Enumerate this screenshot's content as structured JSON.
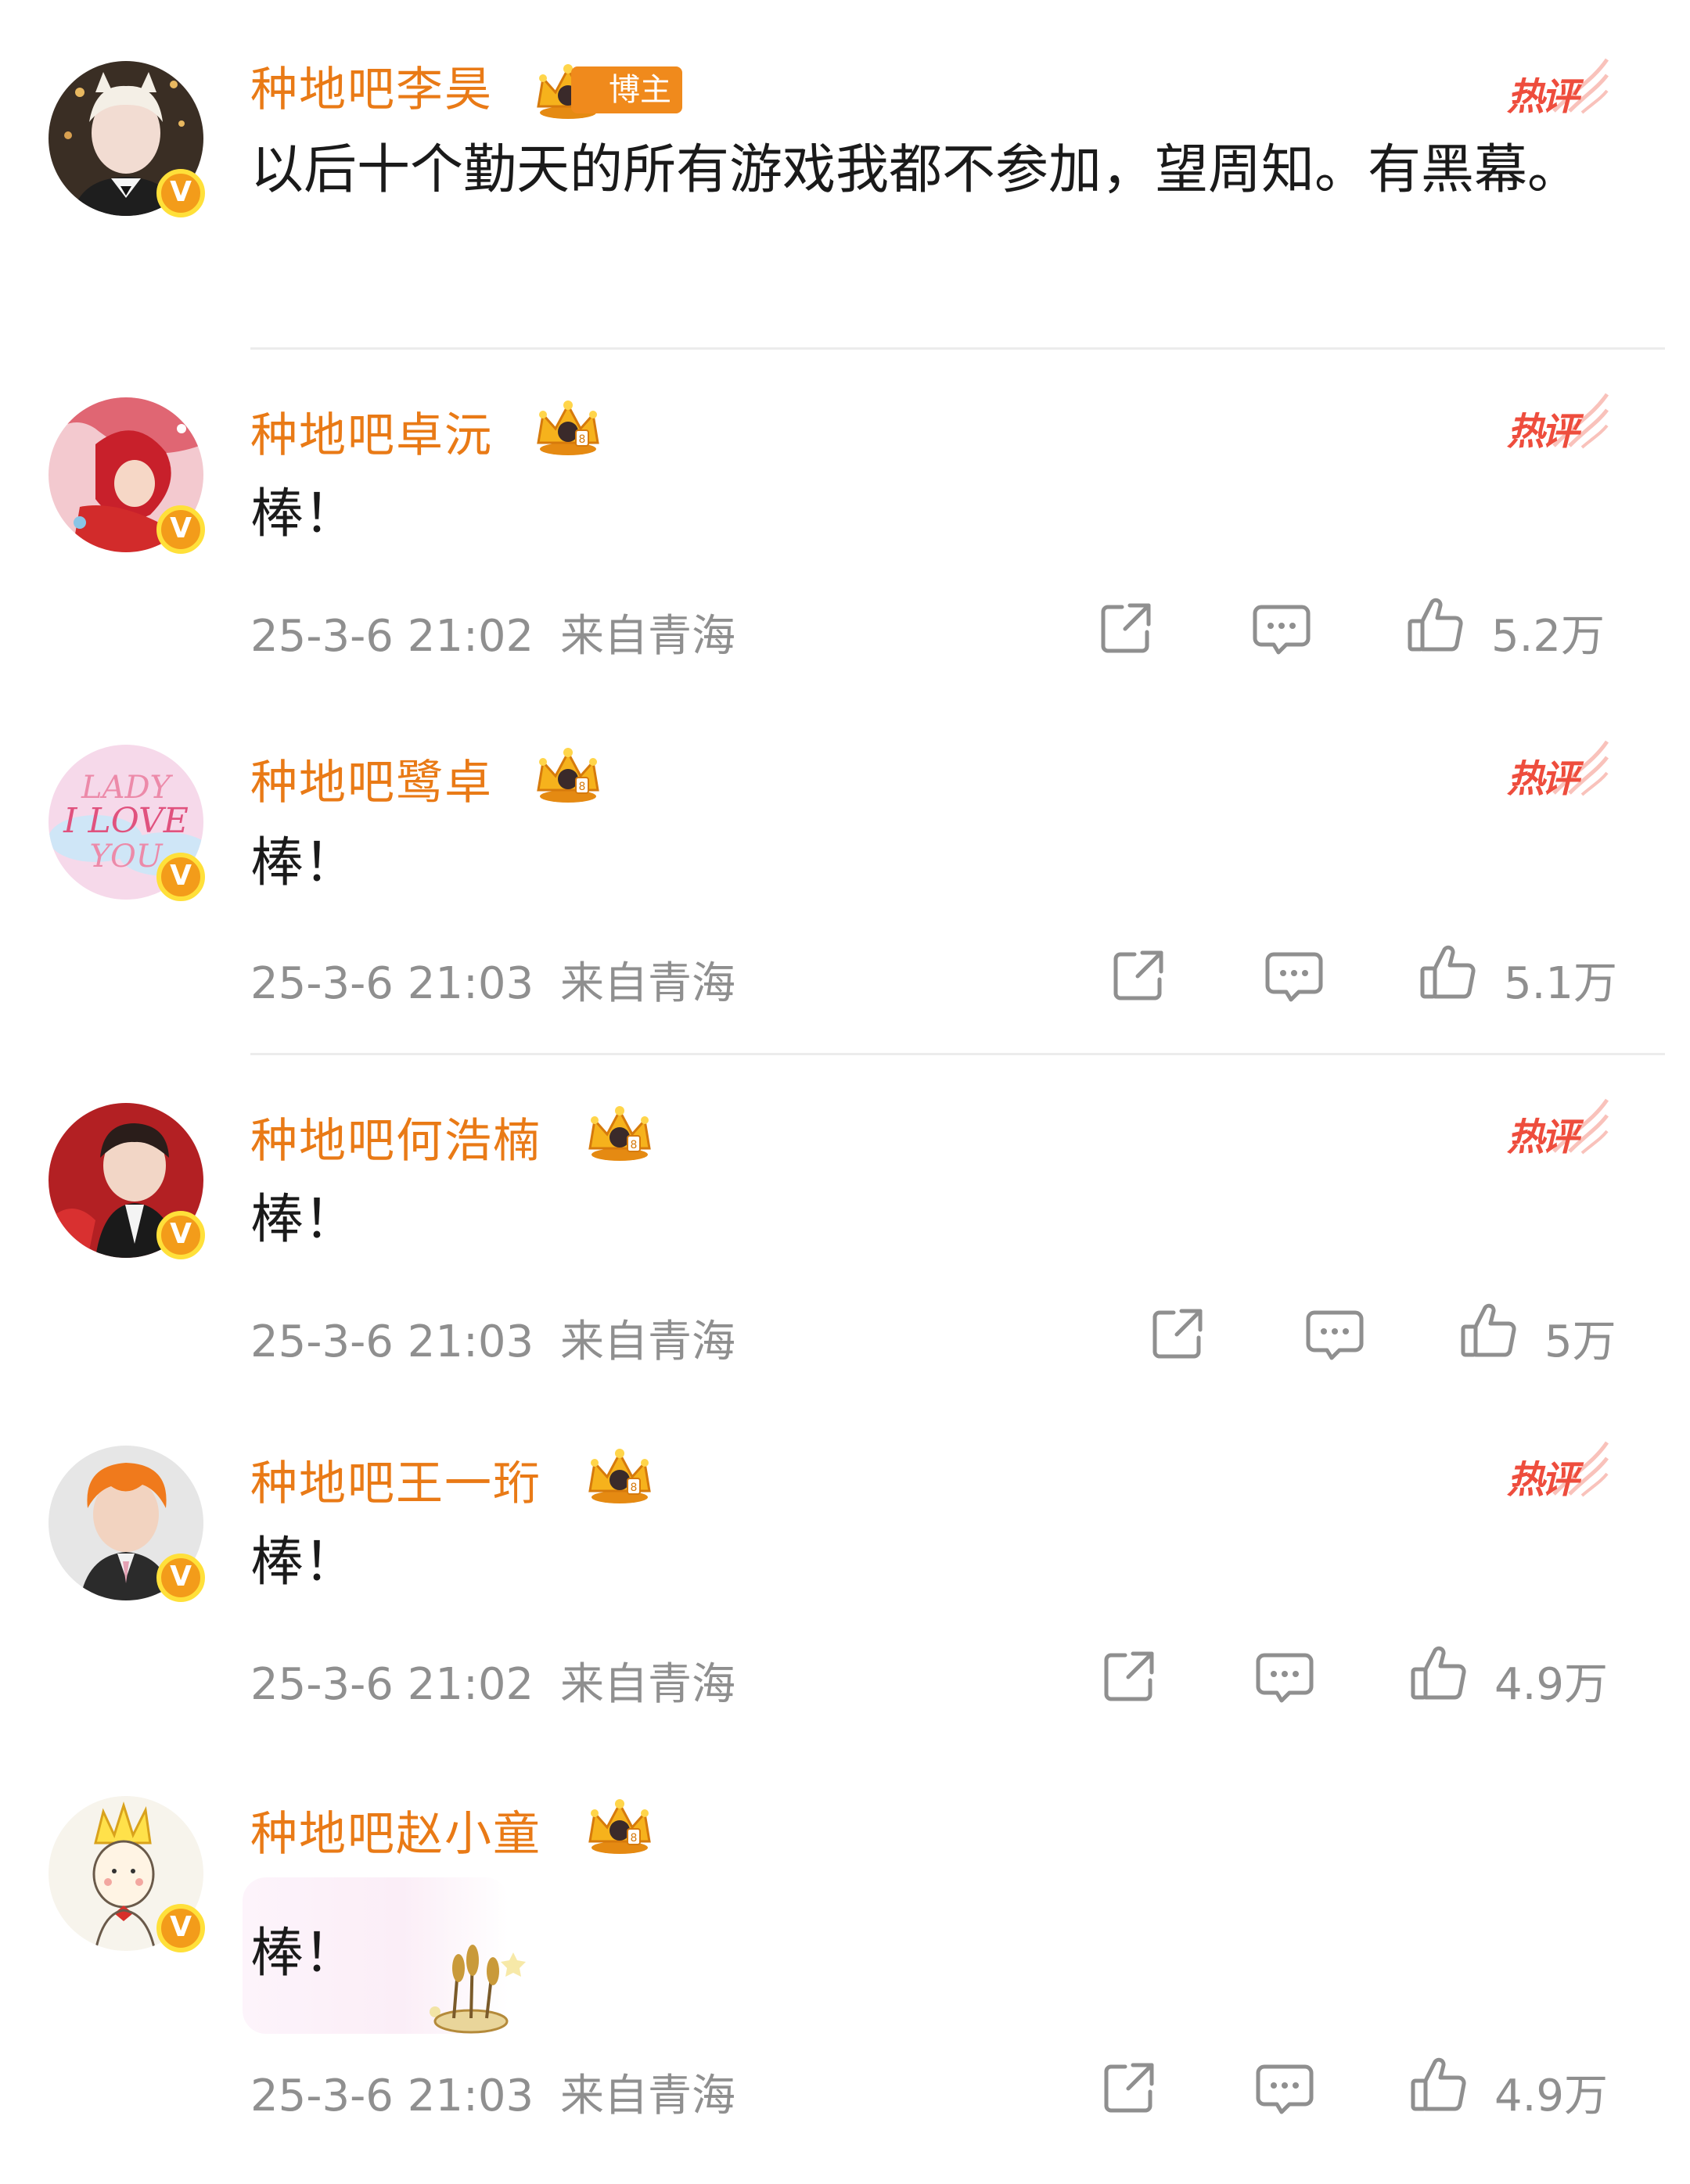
{
  "badges": {
    "verified_mark": "V",
    "hot_label": "热评",
    "blogger_label": "博主"
  },
  "colors": {
    "username": "#e97a16",
    "hot": "#ee4d3d",
    "meta": "#8f8f8f",
    "verified": "#f39c1a"
  },
  "comments": [
    {
      "username": "种地吧李昊",
      "text": "以后十个勤天的所有游戏我都不参加，望周知。有黑幕。",
      "icons": [
        "crown-icon",
        "hot-comment-icon"
      ]
    },
    {
      "username": "种地吧卓沅",
      "text": "棒！",
      "time": "25-3-6 21:02",
      "location": "来自青海",
      "likes": "5.2万",
      "icons": [
        "share-icon",
        "comment-icon",
        "like-icon"
      ]
    },
    {
      "username": "种地吧鹭卓",
      "text": "棒！",
      "time": "25-3-6 21:03",
      "location": "来自青海",
      "likes": "5.1万"
    },
    {
      "username": "种地吧何浩楠",
      "text": "棒！",
      "time": "25-3-6 21:03",
      "location": "来自青海",
      "likes": "5万"
    },
    {
      "username": "种地吧王一珩",
      "text": "棒！",
      "time": "25-3-6 21:02",
      "location": "来自青海",
      "likes": "4.9万"
    },
    {
      "username": "种地吧赵小童",
      "text": "棒！",
      "time": "25-3-6 21:03",
      "location": "来自青海",
      "likes": "4.9万"
    }
  ]
}
